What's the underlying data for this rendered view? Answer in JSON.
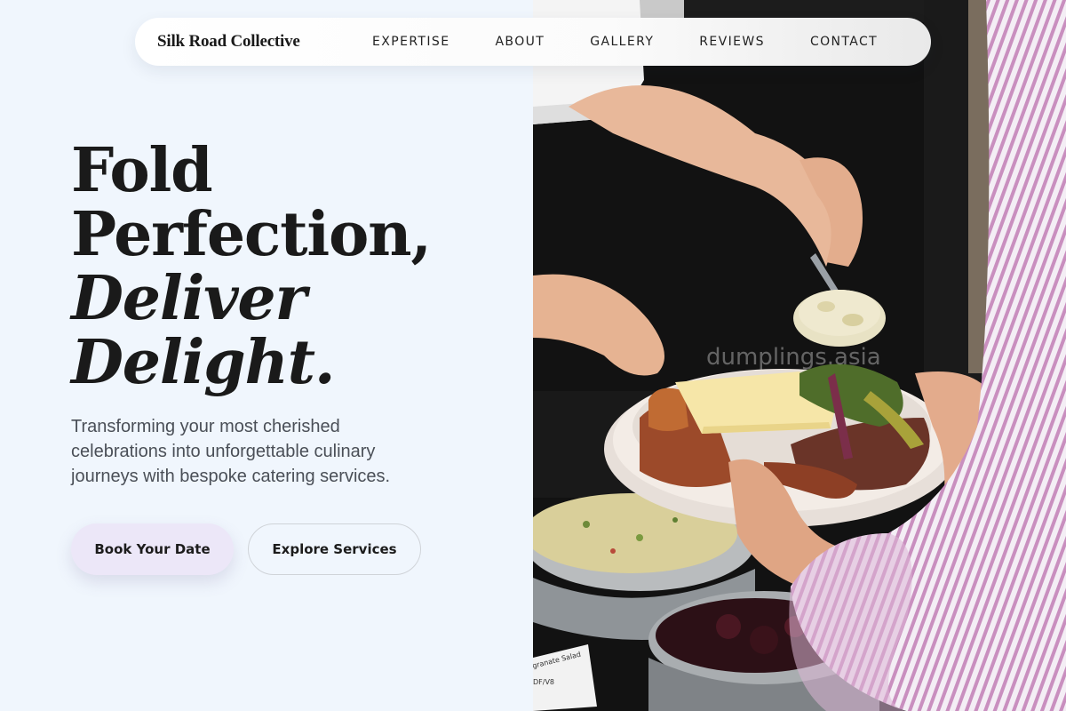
{
  "nav": {
    "brand": "Silk Road Collective",
    "links": [
      "EXPERTISE",
      "ABOUT",
      "GALLERY",
      "REVIEWS",
      "CONTACT"
    ]
  },
  "hero": {
    "headline_line1": "Fold",
    "headline_line2": "Perfection,",
    "headline_line3": "Deliver",
    "headline_line4": "Delight.",
    "subtitle": "Transforming your most cherished celebrations into unforgettable culinary journeys with bespoke catering services.",
    "primary_button": "Book Your Date",
    "secondary_button": "Explore Services"
  },
  "photo": {
    "watermark": "dumplings.asia",
    "sign_text_1": "granate Salad",
    "sign_text_2": "DF/V8"
  },
  "colors": {
    "background": "#f0f6fd",
    "primary_button_bg": "#ece7f8",
    "text_dark": "#1a1a1a",
    "text_muted": "#4a4f57"
  }
}
